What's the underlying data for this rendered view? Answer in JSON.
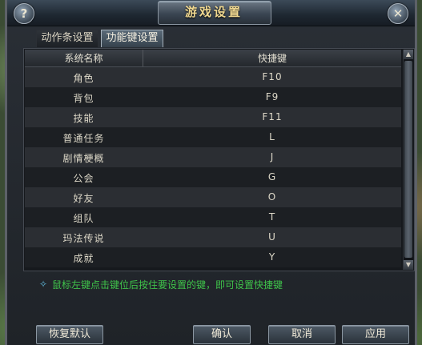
{
  "window": {
    "title": "游戏设置",
    "help_label": "?",
    "close_label": "✕"
  },
  "tabs": [
    {
      "label": "动作条设置",
      "active": false
    },
    {
      "label": "功能键设置",
      "active": true
    }
  ],
  "table": {
    "columns": [
      "系统名称",
      "快捷键"
    ],
    "rows": [
      {
        "name": "角色",
        "key": "F10"
      },
      {
        "name": "背包",
        "key": "F9"
      },
      {
        "name": "技能",
        "key": "F11"
      },
      {
        "name": "普通任务",
        "key": "L"
      },
      {
        "name": "剧情梗概",
        "key": "J"
      },
      {
        "name": "公会",
        "key": "G"
      },
      {
        "name": "好友",
        "key": "O"
      },
      {
        "name": "组队",
        "key": "T"
      },
      {
        "name": "玛法传说",
        "key": "U"
      },
      {
        "name": "成就",
        "key": "Y"
      }
    ]
  },
  "hint": {
    "icon": "diamond-icon",
    "text": "鼠标左键点击键位后按住要设置的键，即可设置快捷键",
    "color": "#3fc24a"
  },
  "buttons": {
    "restore": "恢复默认",
    "confirm": "确认",
    "cancel": "取消",
    "apply": "应用"
  }
}
